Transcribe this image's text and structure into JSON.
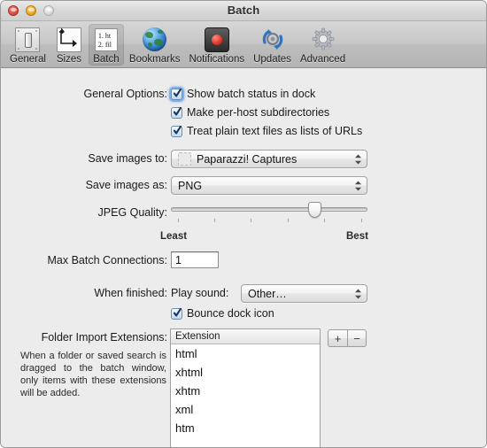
{
  "window": {
    "title": "Batch",
    "traffic_lights": [
      {
        "name": "close",
        "color": "#e05146"
      },
      {
        "name": "minimize",
        "color": "#f0ab28"
      },
      {
        "name": "zoom",
        "color": "#dcdcdc"
      }
    ]
  },
  "toolbar": {
    "selected": "Batch",
    "items": [
      {
        "label": "General",
        "icon": "general-icon"
      },
      {
        "label": "Sizes",
        "icon": "sizes-icon"
      },
      {
        "label": "Batch",
        "icon": "batch-icon"
      },
      {
        "label": "Bookmarks",
        "icon": "globe-icon"
      },
      {
        "label": "Notifications",
        "icon": "record-icon"
      },
      {
        "label": "Updates",
        "icon": "refresh-icon"
      },
      {
        "label": "Advanced",
        "icon": "gear-icon"
      }
    ],
    "batch_icon_lines": [
      "1. ht",
      "2. fil"
    ]
  },
  "general_options": {
    "label": "General Options:",
    "checkboxes": [
      {
        "label": "Show batch status in dock",
        "checked": true,
        "focused": true
      },
      {
        "label": "Make per-host subdirectories",
        "checked": true,
        "focused": false
      },
      {
        "label": "Treat plain text files as lists of URLs",
        "checked": true,
        "focused": false
      }
    ]
  },
  "save_to": {
    "label": "Save images to:",
    "value": "Paparazzi! Captures"
  },
  "save_as": {
    "label": "Save images as:",
    "value": "PNG"
  },
  "jpeg_quality": {
    "label": "JPEG Quality:",
    "min_label": "Least",
    "max_label": "Best",
    "value_percent": 75,
    "tick_count": 6
  },
  "max_connections": {
    "label": "Max Batch Connections:",
    "value": "1"
  },
  "when_finished": {
    "label": "When finished:",
    "sound_label": "Play sound:",
    "sound_value": "Other…",
    "bounce_label": "Bounce dock icon",
    "bounce_checked": true
  },
  "folder_import": {
    "label": "Folder Import Extensions:",
    "help_text": "When a folder or saved search is dragged to the batch window, only items with these extensions will be added.",
    "column_header": "Extension",
    "extensions": [
      "html",
      "xhtml",
      "xhtm",
      "xml",
      "htm"
    ],
    "add_button": "+",
    "remove_button": "−"
  }
}
